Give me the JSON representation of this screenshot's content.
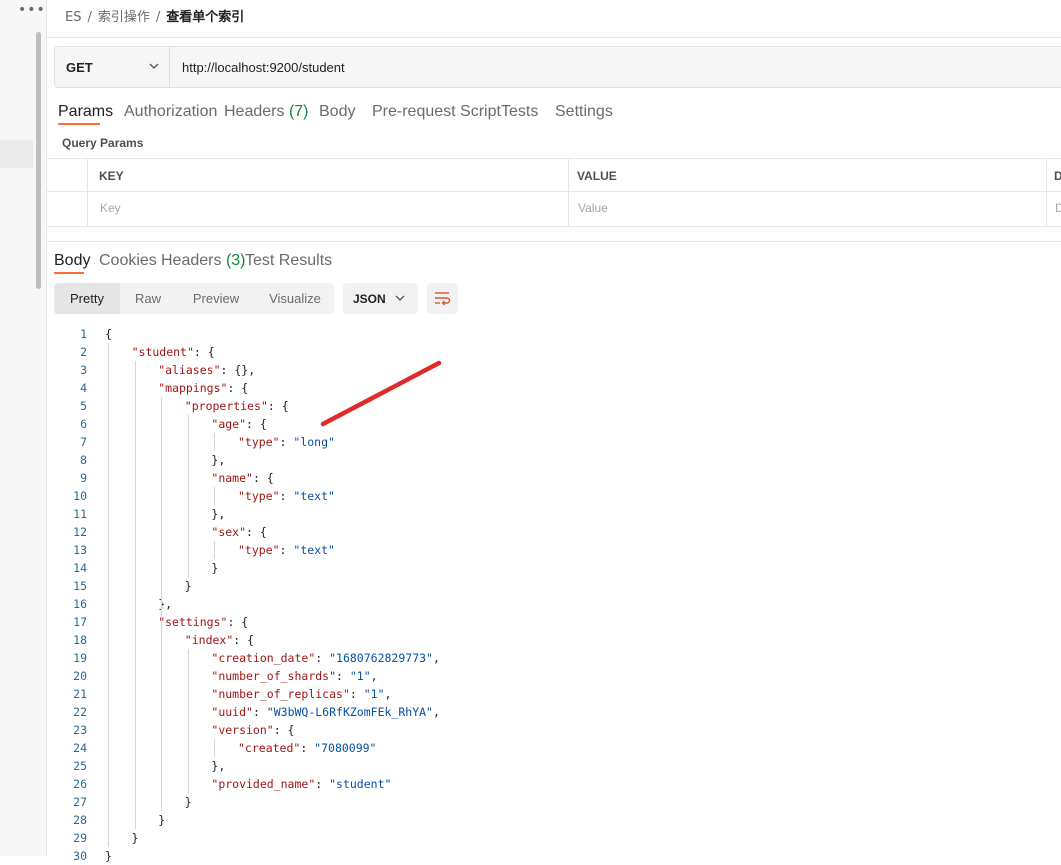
{
  "sidebar": {
    "more_label": "•••"
  },
  "breadcrumb": {
    "root": "ES",
    "folder": "索引操作",
    "current": "查看单个索引",
    "separator": "/"
  },
  "request": {
    "method": "GET",
    "url": "http://localhost:9200/student"
  },
  "request_tabs": [
    {
      "label": "Params"
    },
    {
      "label": "Authorization"
    },
    {
      "label": "Headers",
      "count": "(7)"
    },
    {
      "label": "Body"
    },
    {
      "label": "Pre-request Script"
    },
    {
      "label": "Tests"
    },
    {
      "label": "Settings"
    }
  ],
  "query_params": {
    "title": "Query Params",
    "headers": [
      "KEY",
      "VALUE",
      "D"
    ],
    "placeholders": [
      "Key",
      "Value",
      "D"
    ]
  },
  "response_tabs": [
    {
      "label": "Body"
    },
    {
      "label": "Cookies"
    },
    {
      "label": "Headers",
      "count": "(3)"
    },
    {
      "label": "Test Results"
    }
  ],
  "view_modes": [
    "Pretty",
    "Raw",
    "Preview",
    "Visualize"
  ],
  "format": "JSON",
  "icons": {
    "more": "more-icon",
    "dropdown": "chevron-down-icon",
    "wrap": "wrap-lines-icon"
  },
  "colors": {
    "accent": "#ff6c37",
    "count": "#0b8a3e",
    "annotation": "#e02b2b"
  },
  "code_lines": [
    [
      {
        "t": "{",
        "c": "p"
      }
    ],
    [
      {
        "t": "\"student\"",
        "c": "k"
      },
      {
        "t": ": {",
        "c": "p"
      }
    ],
    [
      {
        "t": "\"aliases\"",
        "c": "k"
      },
      {
        "t": ": {},",
        "c": "p"
      }
    ],
    [
      {
        "t": "\"mappings\"",
        "c": "k"
      },
      {
        "t": ": {",
        "c": "p"
      }
    ],
    [
      {
        "t": "\"properties\"",
        "c": "k"
      },
      {
        "t": ": {",
        "c": "p"
      }
    ],
    [
      {
        "t": "\"age\"",
        "c": "k"
      },
      {
        "t": ": {",
        "c": "p"
      }
    ],
    [
      {
        "t": "\"type\"",
        "c": "k"
      },
      {
        "t": ": ",
        "c": "p"
      },
      {
        "t": "\"long\"",
        "c": "s"
      }
    ],
    [
      {
        "t": "},",
        "c": "p"
      }
    ],
    [
      {
        "t": "\"name\"",
        "c": "k"
      },
      {
        "t": ": {",
        "c": "p"
      }
    ],
    [
      {
        "t": "\"type\"",
        "c": "k"
      },
      {
        "t": ": ",
        "c": "p"
      },
      {
        "t": "\"text\"",
        "c": "s"
      }
    ],
    [
      {
        "t": "},",
        "c": "p"
      }
    ],
    [
      {
        "t": "\"sex\"",
        "c": "k"
      },
      {
        "t": ": {",
        "c": "p"
      }
    ],
    [
      {
        "t": "\"type\"",
        "c": "k"
      },
      {
        "t": ": ",
        "c": "p"
      },
      {
        "t": "\"text\"",
        "c": "s"
      }
    ],
    [
      {
        "t": "}",
        "c": "p"
      }
    ],
    [
      {
        "t": "}",
        "c": "p"
      }
    ],
    [
      {
        "t": "},",
        "c": "p"
      }
    ],
    [
      {
        "t": "\"settings\"",
        "c": "k"
      },
      {
        "t": ": {",
        "c": "p"
      }
    ],
    [
      {
        "t": "\"index\"",
        "c": "k"
      },
      {
        "t": ": {",
        "c": "p"
      }
    ],
    [
      {
        "t": "\"creation_date\"",
        "c": "k"
      },
      {
        "t": ": ",
        "c": "p"
      },
      {
        "t": "\"1680762829773\"",
        "c": "s"
      },
      {
        "t": ",",
        "c": "p"
      }
    ],
    [
      {
        "t": "\"number_of_shards\"",
        "c": "k"
      },
      {
        "t": ": ",
        "c": "p"
      },
      {
        "t": "\"1\"",
        "c": "s"
      },
      {
        "t": ",",
        "c": "p"
      }
    ],
    [
      {
        "t": "\"number_of_replicas\"",
        "c": "k"
      },
      {
        "t": ": ",
        "c": "p"
      },
      {
        "t": "\"1\"",
        "c": "s"
      },
      {
        "t": ",",
        "c": "p"
      }
    ],
    [
      {
        "t": "\"uuid\"",
        "c": "k"
      },
      {
        "t": ": ",
        "c": "p"
      },
      {
        "t": "\"W3bWQ-L6RfKZomFEk_RhYA\"",
        "c": "s"
      },
      {
        "t": ",",
        "c": "p"
      }
    ],
    [
      {
        "t": "\"version\"",
        "c": "k"
      },
      {
        "t": ": {",
        "c": "p"
      }
    ],
    [
      {
        "t": "\"created\"",
        "c": "k"
      },
      {
        "t": ": ",
        "c": "p"
      },
      {
        "t": "\"7080099\"",
        "c": "s"
      }
    ],
    [
      {
        "t": "},",
        "c": "p"
      }
    ],
    [
      {
        "t": "\"provided_name\"",
        "c": "k"
      },
      {
        "t": ": ",
        "c": "p"
      },
      {
        "t": "\"student\"",
        "c": "s"
      }
    ],
    [
      {
        "t": "}",
        "c": "p"
      }
    ],
    [
      {
        "t": "}",
        "c": "p"
      }
    ],
    [
      {
        "t": "}",
        "c": "p"
      }
    ],
    [
      {
        "t": "}",
        "c": "p"
      }
    ]
  ]
}
